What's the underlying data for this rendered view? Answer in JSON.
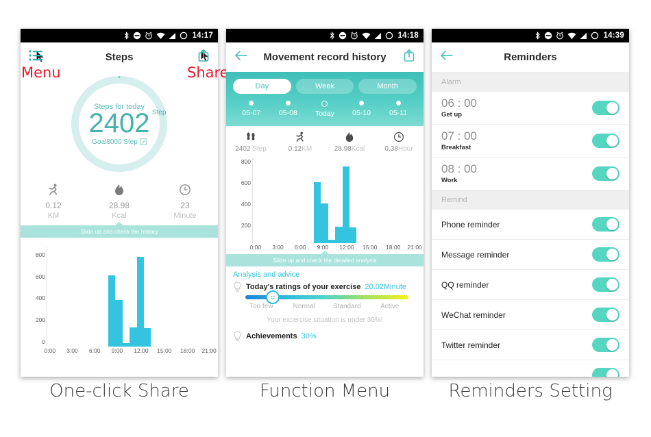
{
  "statusbar": {
    "icons": [
      "bluetooth-icon",
      "do-not-disturb-icon",
      "alarm-icon",
      "wifi-icon",
      "signal-icon",
      "battery-icon"
    ],
    "time1": "14:17",
    "time2": "14:18",
    "time3": "14:39"
  },
  "captions": {
    "one": "One-click Share",
    "two": "Function Menu",
    "three": "Reminders Setting"
  },
  "phone1": {
    "title": "Steps",
    "menu_annotation": "Menu",
    "share_annotation": "Share",
    "ring": {
      "label": "Steps for today",
      "value": "2402",
      "unit": "Step",
      "goal": "Goal8000 Step"
    },
    "stats": [
      {
        "icon": "running-icon",
        "value": "0.12",
        "unit": "KM"
      },
      {
        "icon": "flame-icon",
        "value": "28.98",
        "unit": "Kcal"
      },
      {
        "icon": "clock-icon",
        "value": "23",
        "unit": "Minute"
      }
    ],
    "slide_hint": "Slide up and check the history"
  },
  "phone2": {
    "title": "Movement record history",
    "back_icon": "back-arrow-icon",
    "share_icon": "share-icon",
    "segments": [
      {
        "label": "Day",
        "active": true
      },
      {
        "label": "Week",
        "active": false
      },
      {
        "label": "Month",
        "active": false
      }
    ],
    "dates": [
      {
        "label": "05-07",
        "today": false
      },
      {
        "label": "05-08",
        "today": false
      },
      {
        "label": "Today",
        "today": true
      },
      {
        "label": "05-10",
        "today": false
      },
      {
        "label": "05-11",
        "today": false
      }
    ],
    "stats": [
      {
        "icon": "footsteps-icon",
        "value": "2402",
        "unit": "Step"
      },
      {
        "icon": "running-icon",
        "value": "0.12",
        "unit": "KM"
      },
      {
        "icon": "flame-icon",
        "value": "28.98",
        "unit": "Kcal"
      },
      {
        "icon": "clock-icon",
        "value": "0.38",
        "unit": "Hour"
      }
    ],
    "slide_hint": "Slide up and check the detailed analysis",
    "analysis": {
      "heading": "Analysis and advice",
      "rating_label": "Today's ratings of your exercise",
      "rating_value": "20.02Minute",
      "scale": [
        "Too few",
        "Normal",
        "Standard",
        "Active"
      ],
      "note": "Your excercise situation is under 30%!",
      "achievements_label": "Achievements",
      "achievements_value": "30%"
    }
  },
  "phone3": {
    "title": "Reminders",
    "back_icon": "back-arrow-icon",
    "section_alarm": "Alarm",
    "section_remind": "Remind",
    "alarms": [
      {
        "time": "06 : 00",
        "name": "Get up",
        "on": true
      },
      {
        "time": "07 : 00",
        "name": "Breakfast",
        "on": true
      },
      {
        "time": "08 : 00",
        "name": "Work",
        "on": true
      }
    ],
    "reminders": [
      {
        "name": "Phone reminder",
        "on": true
      },
      {
        "name": "Message reminder",
        "on": true
      },
      {
        "name": "QQ reminder",
        "on": true
      },
      {
        "name": "WeChat reminder",
        "on": true
      },
      {
        "name": "Twitter reminder",
        "on": true
      }
    ]
  },
  "colors": {
    "teal": "#46c3bd",
    "bar_blue": "#35c4e0",
    "ring_track": "#d6eeec",
    "toggle_on": "#56d6c0",
    "annotation_red": "#e8192c"
  },
  "chart_data": [
    {
      "type": "bar",
      "title": "Steps per hour (today)",
      "chart_id": "phone1-steps-chart",
      "xlabel": "",
      "ylabel": "",
      "ylim": [
        0,
        900
      ],
      "yticks": [
        0,
        200,
        400,
        600,
        800
      ],
      "xticks": [
        "0:00",
        "3:00",
        "6:00",
        "9:00",
        "12:00",
        "15:00",
        "18:00",
        "21:00"
      ],
      "grid": false,
      "x_hours": [
        9,
        10,
        11,
        12,
        13,
        14
      ],
      "values": [
        680,
        445,
        35,
        185,
        860,
        175
      ],
      "bar_color": "#35c4e0"
    },
    {
      "type": "bar",
      "title": "Steps per hour (today)",
      "chart_id": "phone2-steps-chart",
      "xlabel": "",
      "ylabel": "",
      "ylim": [
        0,
        900
      ],
      "yticks": [
        200,
        400,
        600,
        800
      ],
      "xticks": [
        "0:00",
        "3:00",
        "6:00",
        "9:00",
        "12:00",
        "15:00",
        "18:00",
        "21:00"
      ],
      "grid": false,
      "x_hours": [
        9,
        10,
        11,
        12,
        13,
        14
      ],
      "values": [
        680,
        445,
        35,
        185,
        860,
        175
      ],
      "bar_color": "#35c4e0"
    }
  ]
}
